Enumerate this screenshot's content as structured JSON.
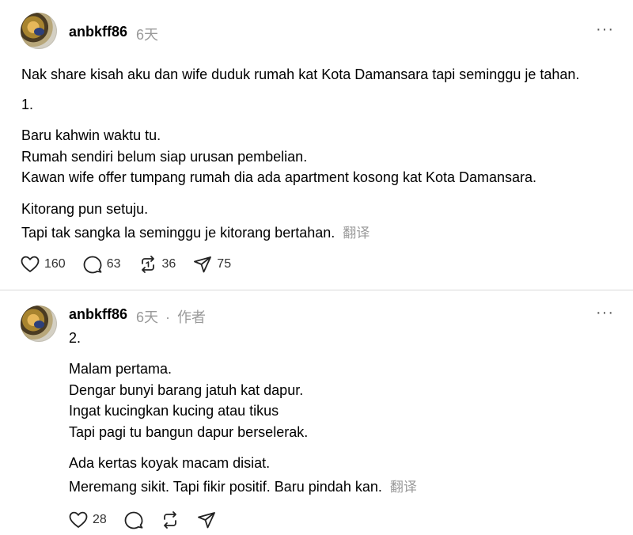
{
  "posts": [
    {
      "username": "anbkff86",
      "time": "6天",
      "lines": [
        "Nak share kisah aku dan wife duduk rumah kat Kota Damansara tapi seminggu je tahan.",
        "1.",
        "Baru kahwin waktu tu.",
        "Rumah sendiri belum siap urusan pembelian.",
        "Kawan wife offer tumpang rumah dia ada apartment kosong kat Kota Damansara.",
        "Kitorang pun setuju.",
        "Tapi tak sangka la seminggu je kitorang bertahan."
      ],
      "translate_label": "翻译",
      "likes": "160",
      "replies": "63",
      "reposts": "36",
      "shares": "75"
    },
    {
      "username": "anbkff86",
      "time": "6天",
      "separator": "·",
      "author_label": "作者",
      "lines": [
        "2.",
        "Malam pertama.",
        "Dengar bunyi barang jatuh kat dapur.",
        "Ingat kucingkan kucing atau tikus",
        "Tapi pagi tu bangun dapur berselerak.",
        "Ada kertas koyak macam disiat.",
        "Meremang sikit. Tapi fikir positif. Baru pindah kan."
      ],
      "translate_label": "翻译",
      "likes": "28"
    }
  ],
  "more_icon": "more-horizontal-icon",
  "icons": [
    "heart-icon",
    "comment-icon",
    "repost-icon",
    "share-icon"
  ]
}
